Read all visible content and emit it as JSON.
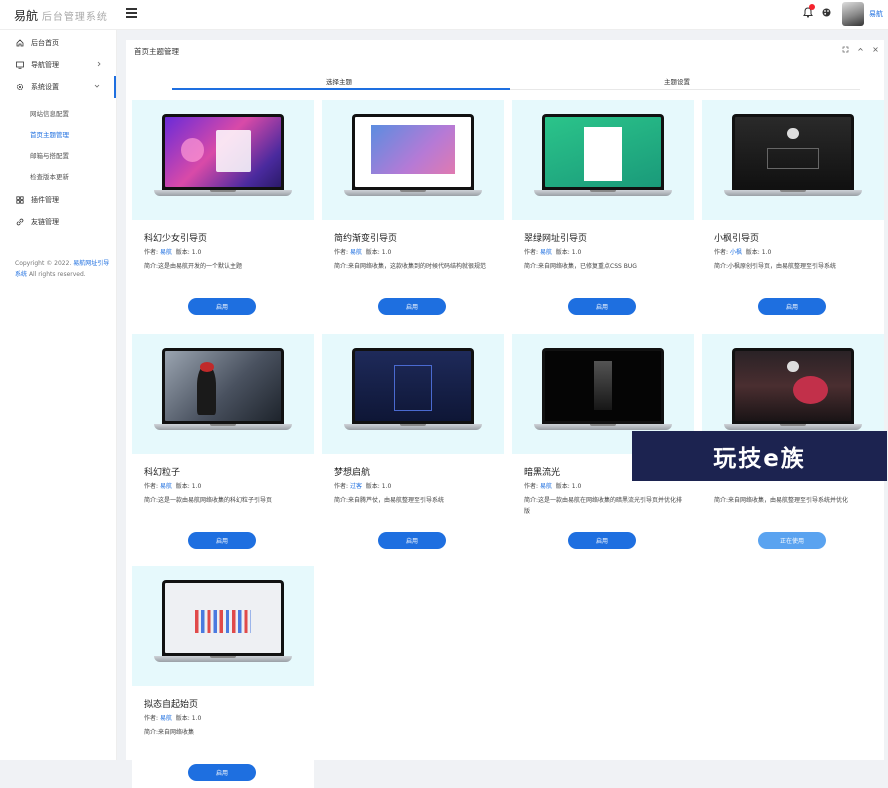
{
  "header": {
    "logo_main": "易航",
    "logo_sub": "后台管理系统",
    "user_name": "易航"
  },
  "sidebar": {
    "items": [
      {
        "label": "后台首页",
        "icon": "home-icon"
      },
      {
        "label": "导航管理",
        "icon": "nav-icon"
      },
      {
        "label": "系统设置",
        "icon": "gear-icon"
      }
    ],
    "sub_items": [
      "网站信息配置",
      "首页主题管理",
      "邮箱与搭配置",
      "检查版本更新"
    ],
    "active_sub": 1,
    "items2": [
      {
        "label": "插件管理",
        "icon": "plugin-icon"
      },
      {
        "label": "友链管理",
        "icon": "link-icon"
      }
    ],
    "copyright_prefix": "Copyright © 2022.",
    "copyright_link": "易航网址引导系统",
    "copyright_suffix": "All rights reserved."
  },
  "panel": {
    "title": "首页主题管理",
    "tabs": [
      "选择主题",
      "主题设置"
    ],
    "active_tab": 0
  },
  "labels": {
    "author": "作者:",
    "version": "版本:",
    "desc": "简介:"
  },
  "themes": [
    {
      "name": "科幻少女引导页",
      "author": "易航",
      "version": "1.0",
      "desc": "这是由易航开发的一个默认主题",
      "button": "启用",
      "in_use": false,
      "art": "anime"
    },
    {
      "name": "简约渐变引导页",
      "author": "易航",
      "version": "1.0",
      "desc": "来自网络收集，这款收集到的时候代码结构就很规范",
      "button": "启用",
      "in_use": false,
      "art": "gradient"
    },
    {
      "name": "翠绿网址引导页",
      "author": "易航",
      "version": "1.0",
      "desc": "来自网络收集，已修复重点CSS BUG",
      "button": "启用",
      "in_use": false,
      "art": "green"
    },
    {
      "name": "小枫引导页",
      "author": "小枫",
      "version": "1.0",
      "desc": "小枫原创引导页，由易航整理至引导系统",
      "button": "启用",
      "in_use": false,
      "art": "dark"
    },
    {
      "name": "科幻粒子",
      "author": "易航",
      "version": "1.0",
      "desc": "这是一款由易航网络收集的科幻粒子引导页",
      "button": "启用",
      "in_use": false,
      "art": "particle"
    },
    {
      "name": "梦想启航",
      "author": "过客",
      "version": "1.0",
      "desc": "来自腾芦仗，由易航整理至引导系统",
      "button": "启用",
      "in_use": false,
      "art": "navy"
    },
    {
      "name": "暗黑流光",
      "author": "易航",
      "version": "1.0",
      "desc": "这是一款由易航在网络收集的暗黑流光引导页并优化排版",
      "button": "启用",
      "in_use": false,
      "art": "black"
    },
    {
      "name": "",
      "author": "",
      "version": "",
      "desc": "来自网络收集，由易航整理至引导系统并优化",
      "button": "正在使用",
      "in_use": true,
      "art": "tree"
    },
    {
      "name": "拟态自起始页",
      "author": "易航",
      "version": "1.0",
      "desc": "来自网络收集",
      "button": "启用",
      "in_use": false,
      "art": "light"
    }
  ],
  "watermark": "玩技e族",
  "colors": {
    "accent": "#1e6fe0",
    "thumb_bg": "#e6f9fc"
  }
}
